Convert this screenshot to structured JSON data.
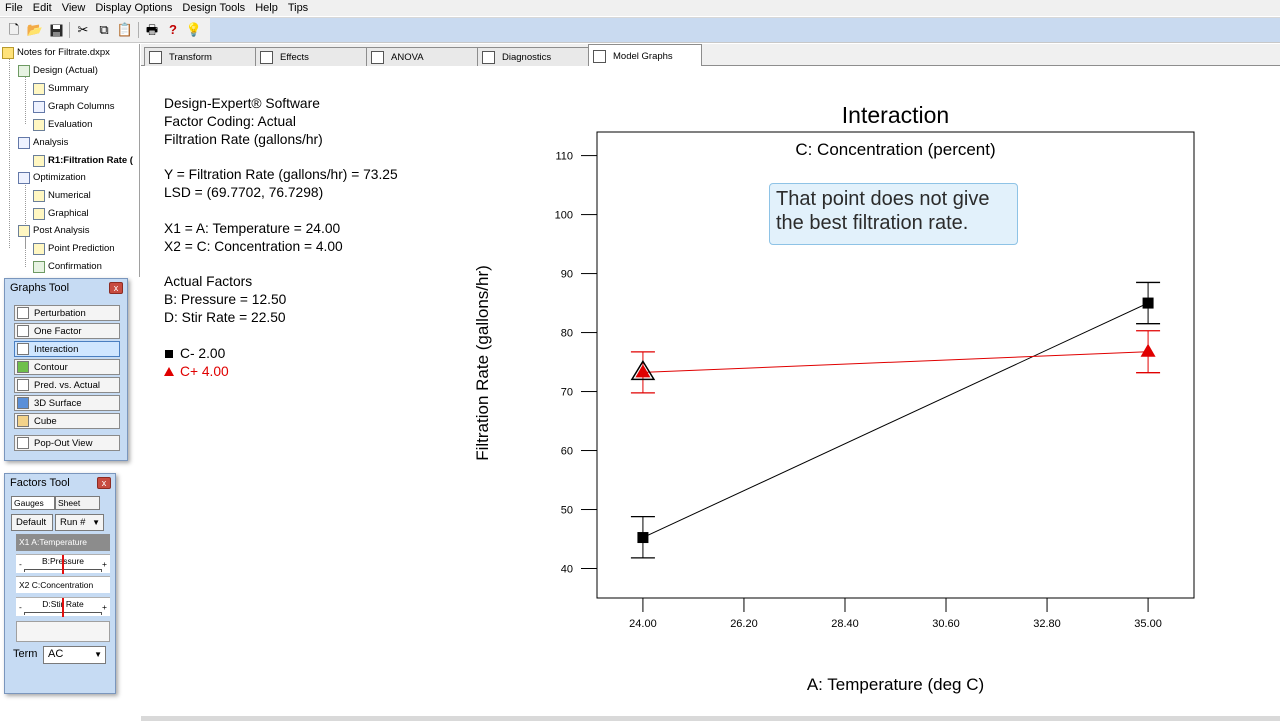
{
  "menu": [
    "File",
    "Edit",
    "View",
    "Display Options",
    "Design Tools",
    "Help",
    "Tips"
  ],
  "toolbar": {
    "icons": [
      "new-file-icon",
      "open-folder-icon",
      "save-icon",
      "cut-icon",
      "copy-icon",
      "paste-icon",
      "print-icon",
      "help-icon",
      "tip-lightbulb-icon"
    ]
  },
  "tree": {
    "root": "Notes for Filtrate.dxpx",
    "items": [
      {
        "label": "Design (Actual)"
      },
      {
        "label": "Summary"
      },
      {
        "label": "Graph Columns"
      },
      {
        "label": "Evaluation"
      },
      {
        "label": "Analysis"
      },
      {
        "label": "R1:Filtration Rate ("
      },
      {
        "label": "Optimization"
      },
      {
        "label": "Numerical"
      },
      {
        "label": "Graphical"
      },
      {
        "label": "Post Analysis"
      },
      {
        "label": "Point Prediction"
      },
      {
        "label": "Confirmation"
      }
    ]
  },
  "graphs_tool": {
    "title": "Graphs Tool",
    "close": "x",
    "buttons": [
      {
        "label": "Perturbation"
      },
      {
        "label": "One Factor"
      },
      {
        "label": "Interaction"
      },
      {
        "label": "Contour"
      },
      {
        "label": "Pred. vs. Actual"
      },
      {
        "label": "3D Surface"
      },
      {
        "label": "Cube"
      },
      {
        "label": "Pop-Out View"
      }
    ]
  },
  "factors_tool": {
    "title": "Factors Tool",
    "close": "x",
    "tabs": [
      "Gauges",
      "Sheet"
    ],
    "default_label": "Default",
    "run_label": "Run #",
    "rows": {
      "x1": "X1 A:Temperature",
      "b": "B:Pressure",
      "x2": "X2 C:Concentration",
      "d": "D:Stir Rate"
    },
    "minus": "-",
    "plus": "+",
    "term_label": "Term",
    "term_value": "AC"
  },
  "tabs": [
    "Transform",
    "Effects",
    "ANOVA",
    "Diagnostics",
    "Model Graphs"
  ],
  "info": {
    "line1": "Design-Expert® Software",
    "line2": "Factor Coding: Actual",
    "line3": "Filtration Rate (gallons/hr)",
    "y": "Y = Filtration Rate (gallons/hr) = 73.25",
    "lsd": "LSD = (69.7702, 76.7298)",
    "x1": "X1 = A: Temperature = 24.00",
    "x2": "X2 = C: Concentration = 4.00",
    "actual_header": "Actual Factors",
    "b": "B: Pressure = 12.50",
    "d": "D: Stir Rate = 22.50",
    "legend_low": "C- 2.00",
    "legend_high": "C+ 4.00"
  },
  "callout": {
    "line1": "That point does not give",
    "line2": "the best filtration rate."
  },
  "chart_data": {
    "type": "line",
    "title": "Interaction",
    "subtitle": "C: Concentration (percent)",
    "xlabel": "A: Temperature (deg C)",
    "ylabel": "Filtration Rate (gallons/hr)",
    "x_ticks": [
      "24.00",
      "26.20",
      "28.40",
      "30.60",
      "32.80",
      "35.00"
    ],
    "y_ticks": [
      "40",
      "50",
      "60",
      "70",
      "80",
      "90",
      "100",
      "110"
    ],
    "xlim": [
      23.0,
      36.0
    ],
    "ylim": [
      35,
      114
    ],
    "series": [
      {
        "name": "C- 2.00",
        "color": "#000000",
        "marker": "square",
        "x": [
          24.0,
          35.0
        ],
        "y": [
          45.25,
          85.0
        ],
        "lsd_low": [
          41.8,
          81.5
        ],
        "lsd_high": [
          48.8,
          88.5
        ]
      },
      {
        "name": "C+ 4.00",
        "color": "#e00000",
        "marker": "triangle",
        "x": [
          24.0,
          35.0
        ],
        "y": [
          73.25,
          76.75
        ],
        "lsd_low": [
          69.77,
          73.2
        ],
        "lsd_high": [
          76.73,
          80.3
        ]
      }
    ]
  }
}
